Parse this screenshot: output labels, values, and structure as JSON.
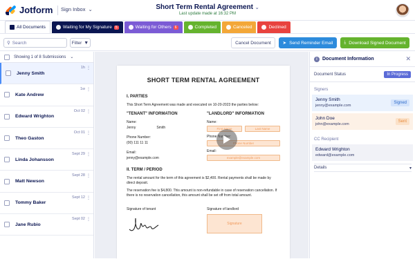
{
  "header": {
    "logo": "Jotform",
    "app": "Sign Inbox",
    "title": "Short Term Rental Agreement",
    "subtitle": "Last update made at 16:32 PM"
  },
  "tabs": [
    {
      "label": "All Documents",
      "color": "#ffffff"
    },
    {
      "label": "Waiting for My Signature",
      "color": "#0a1551",
      "badge": "5"
    },
    {
      "label": "Waiting for Others",
      "color": "#7b5bd5",
      "badge": "6"
    },
    {
      "label": "Completed",
      "color": "#65b32e"
    },
    {
      "label": "Canceled",
      "color": "#f3a738"
    },
    {
      "label": "Declined",
      "color": "#e8423e"
    }
  ],
  "toolbar": {
    "search_placeholder": "Search",
    "filter_label": "Filter",
    "cancel_label": "Cancel Document",
    "remind_label": "Send Reminder Email",
    "download_label": "Download Signed Document"
  },
  "list": {
    "showing": "Showing 1 of 8 Submissions",
    "items": [
      {
        "name": "Jenny Smith",
        "date": "1h"
      },
      {
        "name": "Kate Andrew",
        "date": "1w"
      },
      {
        "name": "Edward Wrighton",
        "date": "Oct 02"
      },
      {
        "name": "Theo Gaston",
        "date": "Oct 01"
      },
      {
        "name": "Linda Johansson",
        "date": "Sept 29"
      },
      {
        "name": "Matt Newson",
        "date": "Sept 28"
      },
      {
        "name": "Tommy Baker",
        "date": "Sept 12"
      },
      {
        "name": "Jane Rubio",
        "date": "Sept 02"
      }
    ]
  },
  "document": {
    "title": "SHORT TERM RENTAL AGREEMENT",
    "sec1": "I. PARTIES",
    "intro": "This Short Term Agreement was made and executed on 10-20-2023 the parties below:",
    "tenant_title": "\"TENANT\" INFORMATION",
    "landlord_title": "\"LANDLORD\" INFORMATION",
    "name_label": "Name:",
    "tenant_first": "Jenny",
    "tenant_last": "Smith",
    "first_name_ph": "First Name",
    "last_name_ph": "Last Name",
    "phone_label": "Phone Number:",
    "tenant_phone": "(00) 111 11 11",
    "phone_ph": "Phone Number",
    "email_label": "Email:",
    "tenant_email": "jenny@example.com",
    "email_ph": "example@example.com",
    "sec2": "II. TERM / PERIOD",
    "term1": "The rental amount for the term of this agreement is $2,400. Rental payments shall be made by direct deposit.",
    "term2": "The reservation fee is $4,800. This amount is non-refundable in case of reservation cancellation. If there is no reservation cancellation, this amount shall be set off from total amount.",
    "sig_tenant": "Signature of tenant",
    "sig_landlord": "Signature of landlord",
    "sig_ph": "Signature"
  },
  "panel": {
    "title": "Document Information",
    "status_label": "Document Status",
    "status_value": "In Progress",
    "signers_label": "Signers",
    "signers": [
      {
        "name": "Jenny Smith",
        "email": "jenny@example.com",
        "state": "Signed"
      },
      {
        "name": "John Doe",
        "email": "john@example.com",
        "state": "Sent"
      }
    ],
    "cc_label": "CC Recipient",
    "cc": {
      "name": "Edward Wrighton",
      "email": "edward@example.com"
    },
    "details_label": "Details"
  }
}
